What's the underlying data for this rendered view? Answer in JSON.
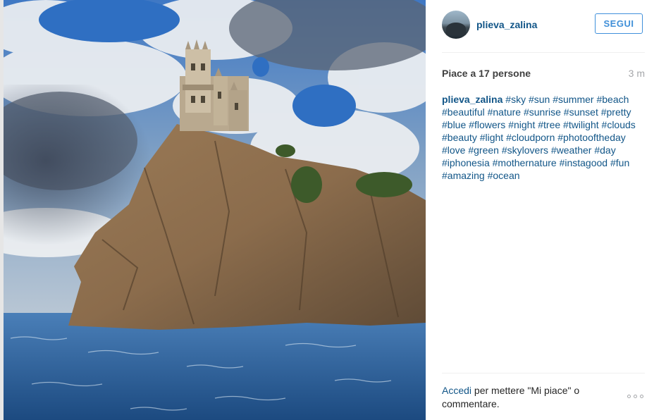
{
  "post": {
    "username": "plieva_zalina",
    "follow_label": "SEGUI",
    "likes": "Piace a 17 persone",
    "time_ago": "3 m",
    "caption_author": "plieva_zalina",
    "hashtags": [
      "#sky",
      "#sun",
      "#summer",
      "#beach",
      "#beautiful",
      "#nature",
      "#sunrise",
      "#sunset",
      "#pretty",
      "#blue",
      "#flowers",
      "#night",
      "#tree",
      "#twilight",
      "#clouds",
      "#beauty",
      "#light",
      "#cloudporn",
      "#photooftheday",
      "#love",
      "#green",
      "#skylovers",
      "#weather",
      "#day",
      "#iphonesia",
      "#mothernature",
      "#instagood",
      "#fun",
      "#amazing",
      "#ocean"
    ]
  },
  "footer": {
    "login_link": "Accedi",
    "rest_text": " per mettere \"Mi piace\" o commentare."
  },
  "icons": {
    "more_options": "ellipsis-icon"
  },
  "colors": {
    "link_blue": "#125688",
    "follow_blue": "#3f8fd8",
    "muted_gray": "#a5a7aa"
  }
}
